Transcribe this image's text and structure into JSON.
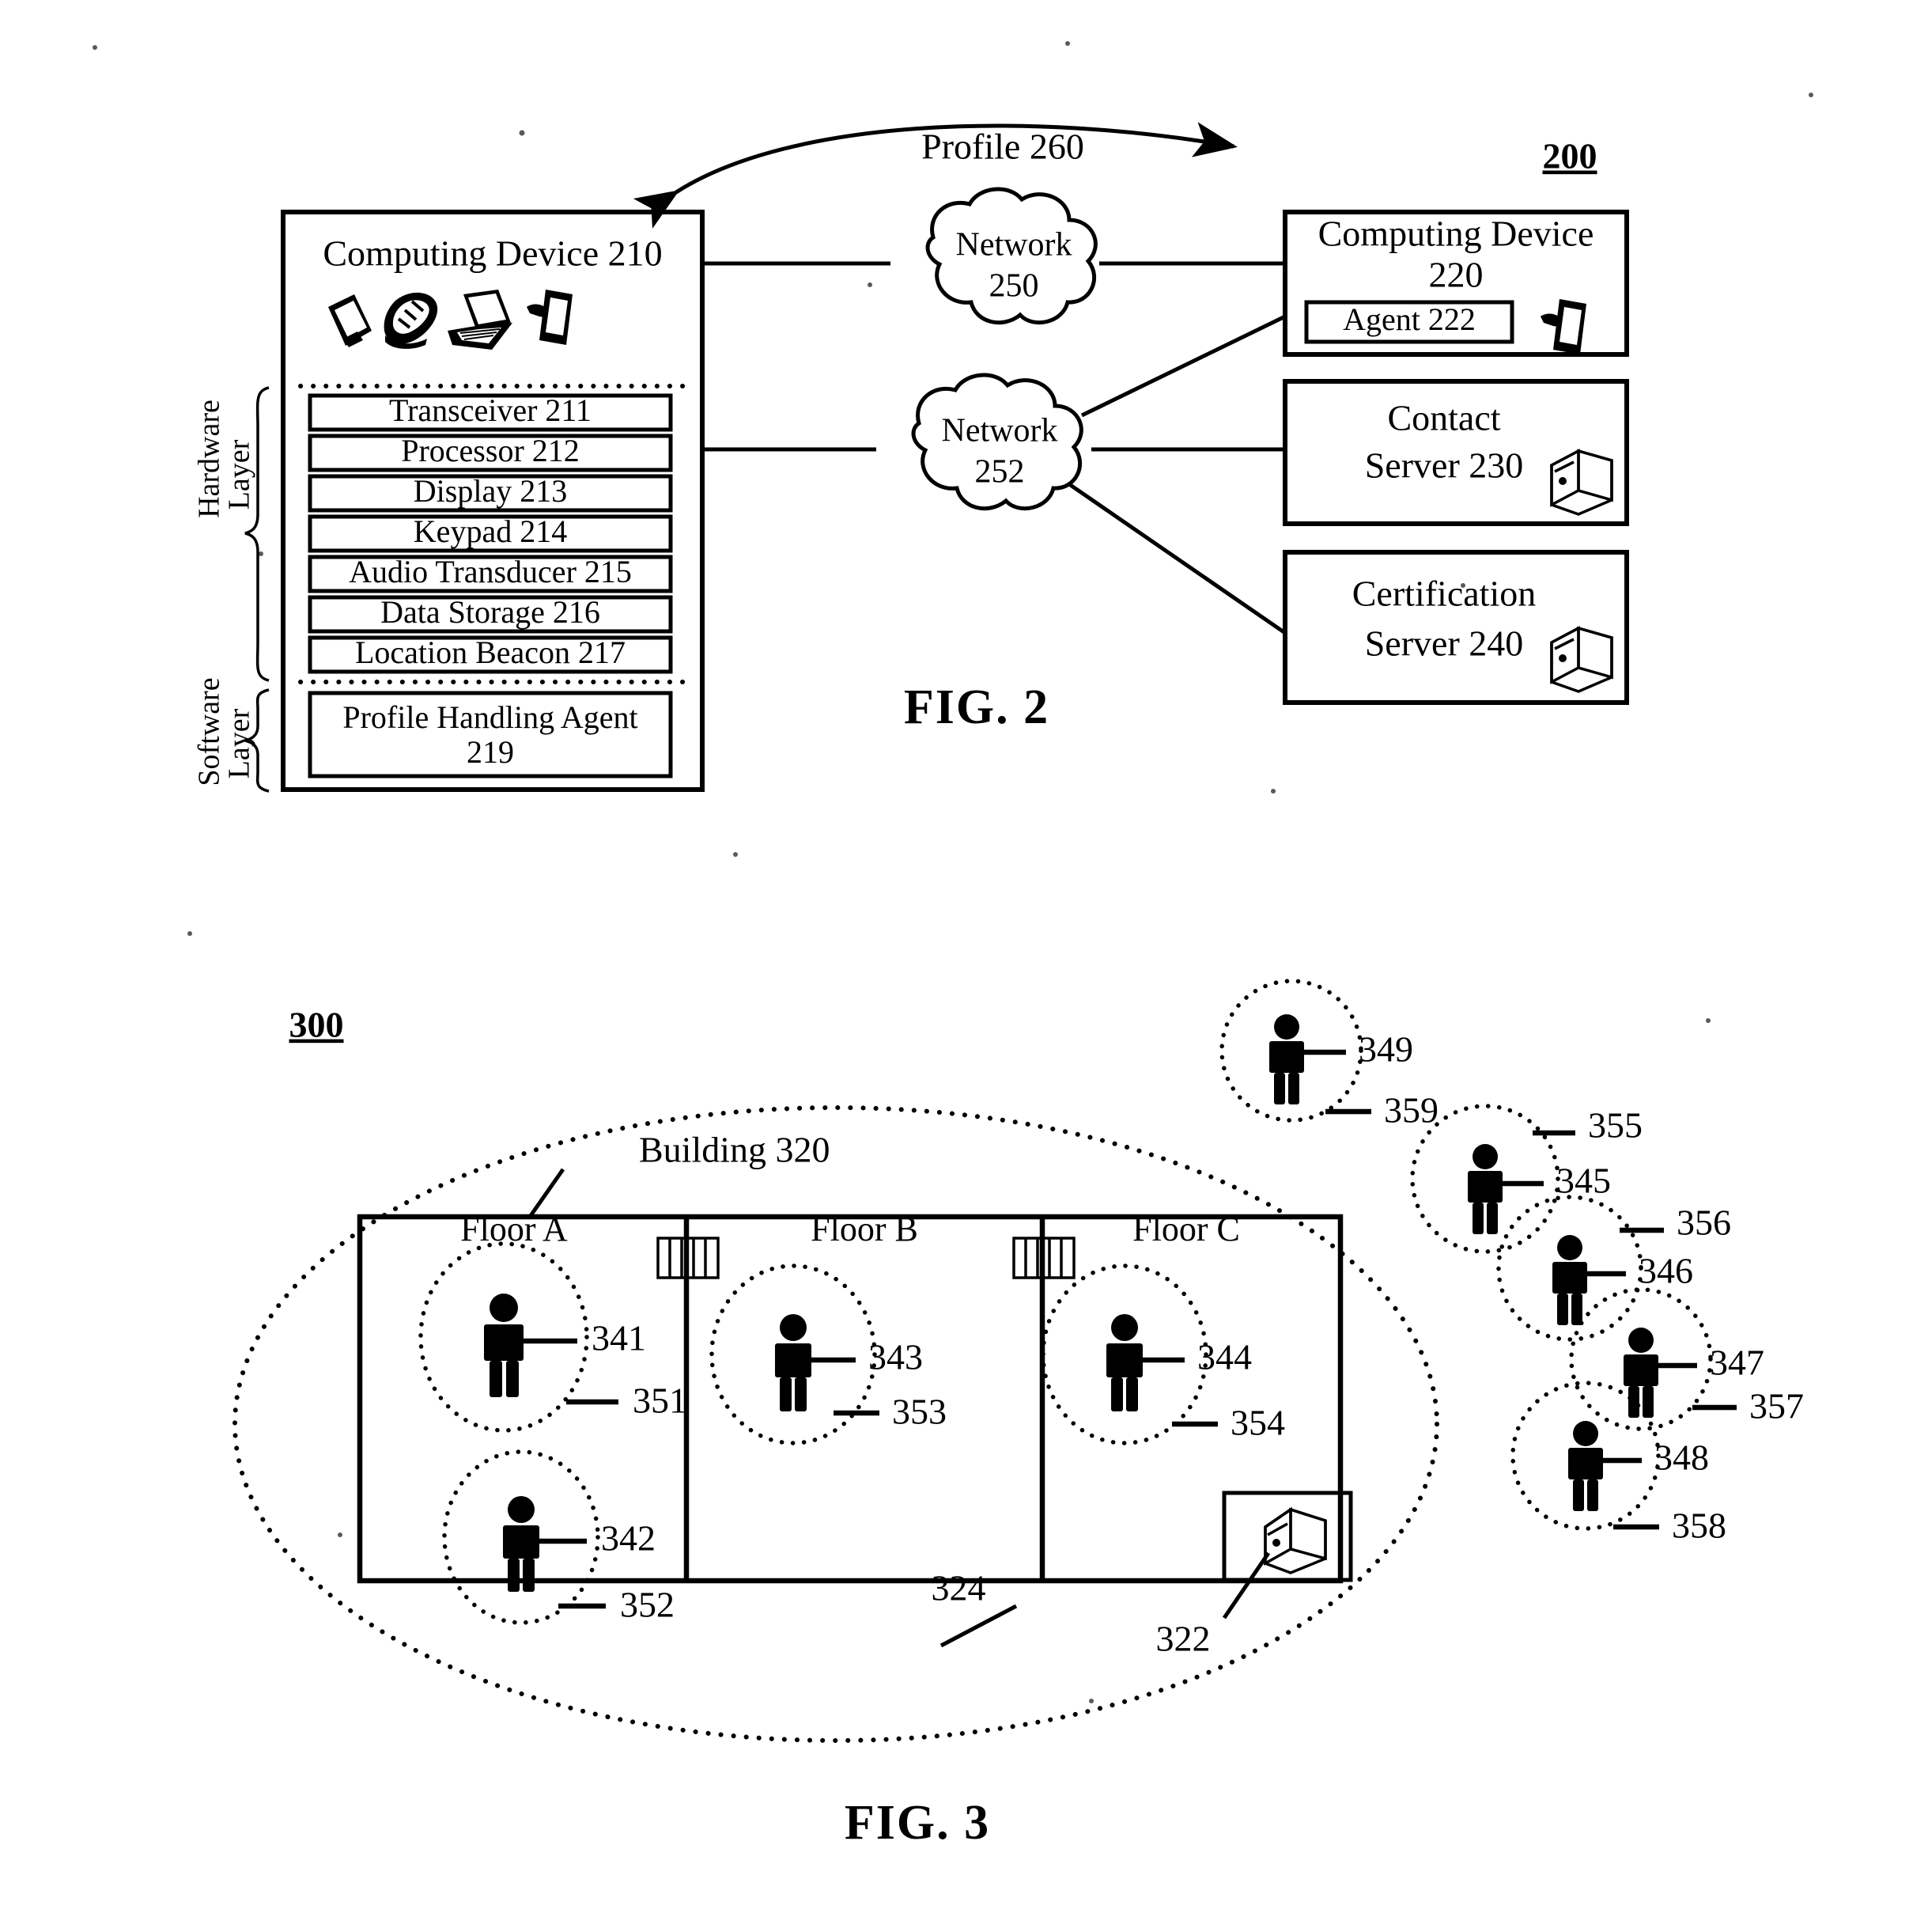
{
  "figure2": {
    "figure_label": "FIG. 2",
    "system_ref": "200",
    "profile_link_label": "Profile 260",
    "device_left": {
      "title": "Computing Device 210",
      "device_icons": [
        "pda-icon",
        "flip-phone-icon",
        "laptop-icon",
        "mobile-phone-icon"
      ],
      "hardware_items": [
        "Transceiver 211",
        "Processor 212",
        "Display 213",
        "Keypad 214",
        "Audio Transducer 215",
        "Data Storage 216",
        "Location Beacon 217"
      ],
      "software_items": [
        "Profile Handling Agent 219"
      ],
      "software_item_line1": "Profile Handling Agent",
      "software_item_line2": "219",
      "brace_hardware": "Hardware\nLayer",
      "brace_hardware_line1": "Hardware",
      "brace_hardware_line2": "Layer",
      "brace_software_line1": "Software",
      "brace_software_line2": "Layer"
    },
    "networks": [
      {
        "line1": "Network",
        "line2": "250"
      },
      {
        "line1": "Network",
        "line2": "252"
      }
    ],
    "device_right": {
      "title_line1": "Computing Device",
      "title_line2": "220",
      "agent_label": "Agent 222",
      "icon": "mobile-phone-icon"
    },
    "servers": [
      {
        "line1": "Contact",
        "line2": "Server 230",
        "icon": "server-tower-icon"
      },
      {
        "line1": "Certification",
        "line2": "Server 240",
        "icon": "server-tower-icon"
      }
    ]
  },
  "figure3": {
    "figure_label": "FIG. 3",
    "system_ref": "300",
    "building_label": "Building 320",
    "server_ref": "322",
    "outer_zone_ref": "324",
    "floors": [
      {
        "label": "Floor A"
      },
      {
        "label": "Floor B"
      },
      {
        "label": "Floor C"
      }
    ],
    "stair_icons": [
      "stairs-icon",
      "stairs-icon"
    ],
    "server_icon": "server-tower-icon",
    "people": [
      {
        "person_ref": "341",
        "zone_ref": "351",
        "location": "Floor A"
      },
      {
        "person_ref": "342",
        "zone_ref": "352",
        "location": "Floor A"
      },
      {
        "person_ref": "343",
        "zone_ref": "353",
        "location": "Floor B"
      },
      {
        "person_ref": "344",
        "zone_ref": "354",
        "location": "Floor C"
      },
      {
        "person_ref": "345",
        "zone_ref": "355",
        "location": "outside"
      },
      {
        "person_ref": "346",
        "zone_ref": "356",
        "location": "outside"
      },
      {
        "person_ref": "347",
        "zone_ref": "357",
        "location": "outside"
      },
      {
        "person_ref": "348",
        "zone_ref": "358",
        "location": "outside"
      },
      {
        "person_ref": "349",
        "zone_ref": "359",
        "location": "outside"
      }
    ]
  }
}
